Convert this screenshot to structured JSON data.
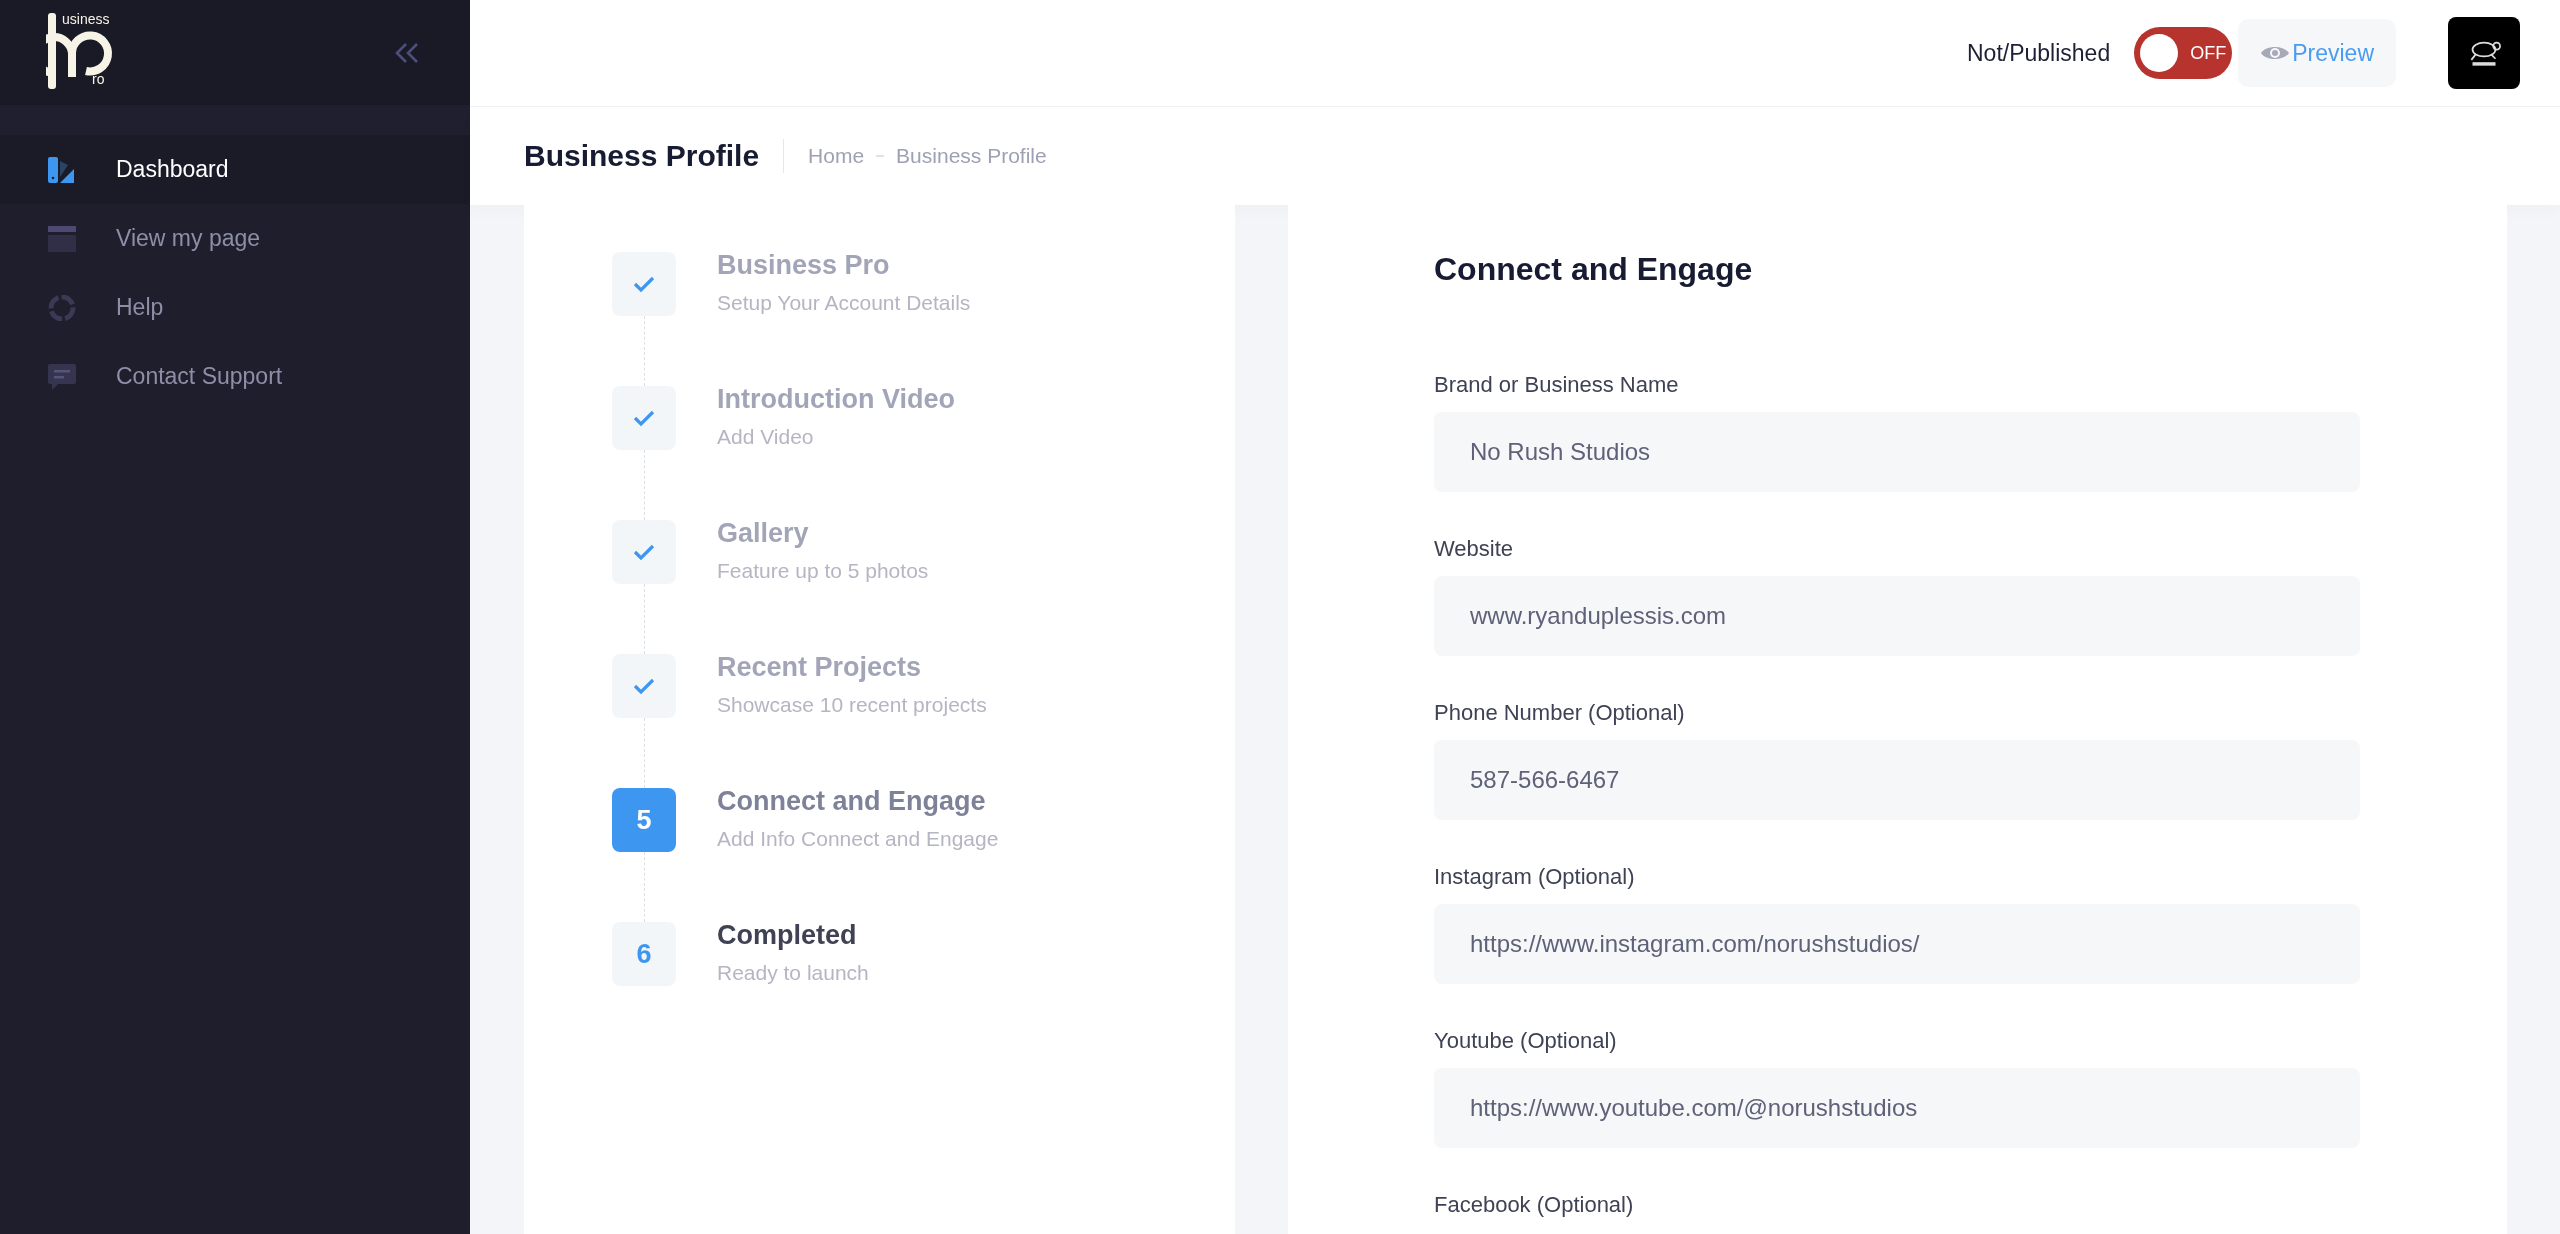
{
  "sidebar": {
    "logo": {
      "top_text": "usiness",
      "bottom_text": "ro"
    },
    "items": [
      {
        "label": "Dashboard",
        "kind": "dashboard",
        "selected": true
      },
      {
        "label": "View my page",
        "kind": "page",
        "selected": false
      },
      {
        "label": "Help",
        "kind": "help",
        "selected": false
      },
      {
        "label": "Contact Support",
        "kind": "support",
        "selected": false
      }
    ]
  },
  "header": {
    "publish_label": "Not/Published",
    "publish_toggle": {
      "on": false,
      "label": "OFF"
    },
    "preview_button": "Preview"
  },
  "page_header": {
    "title": "Business Profile",
    "breadcrumb": [
      "Home",
      "Business Profile"
    ]
  },
  "steps": [
    {
      "title": "Business Pro",
      "subtitle": "Setup Your Account Details",
      "completed": true,
      "selected": false
    },
    {
      "title": "Introduction Video",
      "subtitle": "Add Video",
      "completed": true,
      "selected": false
    },
    {
      "title": "Gallery",
      "subtitle": "Feature up to 5 photos",
      "completed": true,
      "selected": false
    },
    {
      "title": "Recent Projects",
      "subtitle": "Showcase 10 recent projects",
      "completed": true,
      "selected": false
    },
    {
      "title": "Connect and Engage",
      "subtitle": "Add Info Connect and Engage",
      "completed": false,
      "selected": true,
      "number": "5"
    },
    {
      "title": "Completed",
      "subtitle": "Ready to launch",
      "completed": false,
      "selected": false,
      "number": "6"
    }
  ],
  "form": {
    "title": "Connect and Engage",
    "fields": [
      {
        "label": "Brand or Business Name",
        "value": "No Rush Studios"
      },
      {
        "label": "Website",
        "value": "www.ryanduplessis.com"
      },
      {
        "label": "Phone Number (Optional)",
        "value": "587-566-6467"
      },
      {
        "label": "Instagram (Optional)",
        "value": "https://www.instagram.com/norushstudios/"
      },
      {
        "label": "Youtube (Optional)",
        "value": "https://www.youtube.com/@norushstudios"
      },
      {
        "label": "Facebook (Optional)"
      }
    ]
  }
}
